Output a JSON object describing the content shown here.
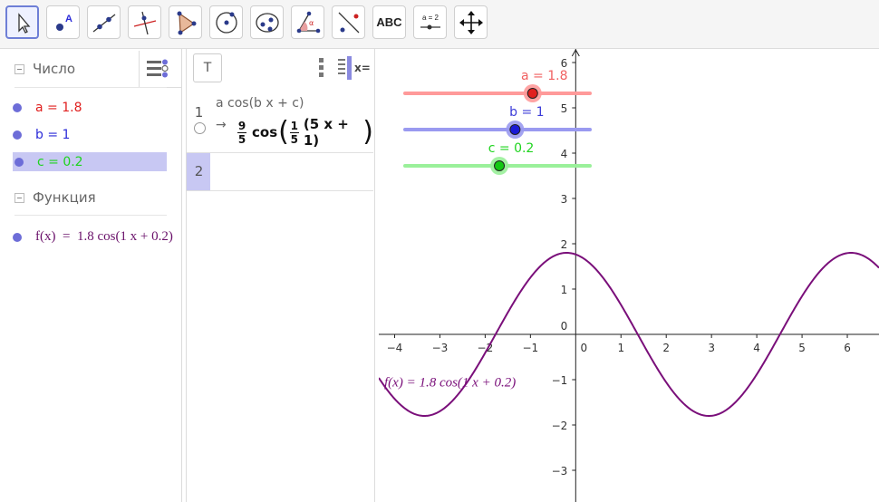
{
  "toolbar": {
    "tools": [
      {
        "name": "move-tool"
      },
      {
        "name": "point-tool"
      },
      {
        "name": "line-tool"
      },
      {
        "name": "perpendicular-line-tool"
      },
      {
        "name": "polygon-tool"
      },
      {
        "name": "circle-center-point-tool"
      },
      {
        "name": "ellipse-tool"
      },
      {
        "name": "angle-tool"
      },
      {
        "name": "reflect-tool"
      },
      {
        "name": "text-tool",
        "label": "ABC"
      },
      {
        "name": "slider-tool",
        "label": "a = 2"
      },
      {
        "name": "move-graphics-view-tool"
      }
    ]
  },
  "algebra": {
    "group_number": "Число",
    "items": [
      {
        "text": "a = 1.8",
        "color": "#e0201f"
      },
      {
        "text": "b = 1",
        "color": "#2b2bd8"
      },
      {
        "text": "c = 0.2",
        "color": "#1fd41f",
        "selected": true
      }
    ],
    "group_function": "Функция",
    "function_text": "f(x)  =  1.8 cos(1 x + 0.2)",
    "function_color": "#6a116a"
  },
  "cas": {
    "toolbar_text_button": "T",
    "toolbar_xeq": "x=",
    "row1_number": "1",
    "row1_input": "a cos(b x + c)",
    "row1_arrow": "→",
    "row1_output": {
      "frac1_num": "9",
      "frac1_den": "5",
      "func": "cos",
      "frac2_num": "1",
      "frac2_den": "5",
      "inner": "(5 x + 1)"
    },
    "row2_number": "2"
  },
  "graphics": {
    "sliders": [
      {
        "label": "a = 1.8",
        "value": 1.8,
        "fraction": 0.69,
        "color": "#f06060",
        "track": "#ff9a9a",
        "knob": "#e0201f"
      },
      {
        "label": "b = 1",
        "value": 1,
        "fraction": 0.595,
        "color": "#3b3bd8",
        "track": "#9a9af0",
        "knob": "#1a1ad6"
      },
      {
        "label": "c = 0.2",
        "value": 0.2,
        "fraction": 0.51,
        "color": "#1fd41f",
        "track": "#9af09a",
        "knob": "#14c814"
      }
    ],
    "x_ticks": [
      "-4",
      "-3",
      "-2",
      "-1",
      "0",
      "1",
      "2",
      "3",
      "4",
      "5",
      "6"
    ],
    "y_ticks": [
      "-3",
      "-2",
      "-1",
      "0",
      "1",
      "2",
      "3",
      "4",
      "5",
      "6"
    ],
    "function_label": "f(x)  =  1.8 cos(1 x + 0.2)",
    "function_color": "#7a0f7a",
    "function": {
      "a": 1.8,
      "b": 1,
      "c": 0.2
    },
    "x_range": [
      -4.35,
      6.7
    ],
    "y_range": [
      -3.7,
      6.3
    ]
  }
}
